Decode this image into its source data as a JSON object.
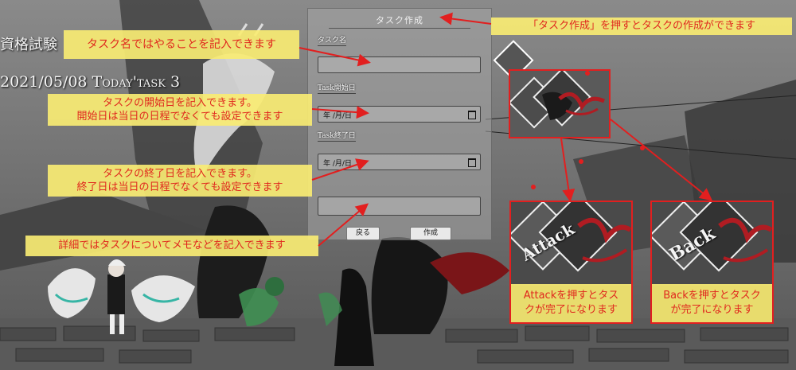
{
  "header": {
    "title": "資格試験",
    "date_line": "2021/05/08 Today'task 3"
  },
  "form": {
    "title": "タスク作成",
    "name_label": "タスク名",
    "start_label": "Task開始日",
    "start_value": "年 /月/日",
    "end_label": "Task終了日",
    "end_value": "年 /月/日",
    "back_button": "戻る",
    "create_button": "作成"
  },
  "annotations": {
    "create": "「タスク作成」を押すとタスクの作成ができます",
    "name": "タスク名ではやることを記入できます",
    "start_1": "タスクの開始日を記入できます。",
    "start_2": "開始日は当日の日程でなくても設定できます",
    "end_1": "タスクの終了日を記入できます。",
    "end_2": "終了日は当日の日程でなくても設定できます",
    "detail": "詳細ではタスクについてメモなどを記入できます",
    "attack_1": "Attackを押すとタス",
    "attack_2": "クが完了になります",
    "back_1": "Backを押すとタスク",
    "back_2": "が完了になります"
  },
  "cards": {
    "attack_word": "Attack",
    "back_word": "Back"
  },
  "colors": {
    "note_bg": "#f8ec73",
    "note_text": "#e0281e",
    "highlight": "#e21f1f"
  }
}
